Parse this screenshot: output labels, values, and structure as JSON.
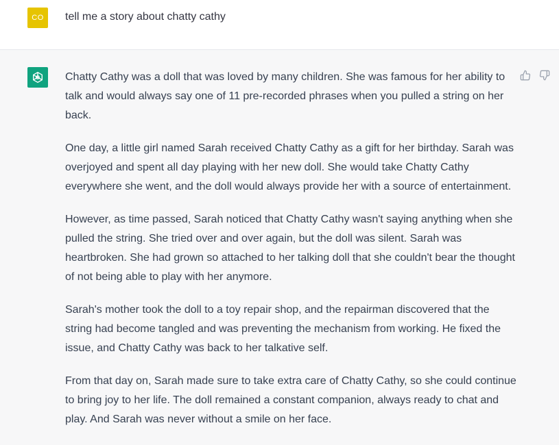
{
  "conversation": {
    "user_turn": {
      "avatar_initials": "CO",
      "message": "tell me a story about chatty cathy"
    },
    "assistant_turn": {
      "avatar_icon": "openai-logo-icon",
      "paragraphs": [
        "Chatty Cathy was a doll that was loved by many children. She was famous for her ability to talk and would always say one of 11 pre-recorded phrases when you pulled a string on her back.",
        "One day, a little girl named Sarah received Chatty Cathy as a gift for her birthday. Sarah was overjoyed and spent all day playing with her new doll. She would take Chatty Cathy everywhere she went, and the doll would always provide her with a source of entertainment.",
        "However, as time passed, Sarah noticed that Chatty Cathy wasn't saying anything when she pulled the string. She tried over and over again, but the doll was silent. Sarah was heartbroken. She had grown so attached to her talking doll that she couldn't bear the thought of not being able to play with her anymore.",
        "Sarah's mother took the doll to a toy repair shop, and the repairman discovered that the string had become tangled and was preventing the mechanism from working. He fixed the issue, and Chatty Cathy was back to her talkative self.",
        "From that day on, Sarah made sure to take extra care of Chatty Cathy, so she could continue to bring joy to her life. The doll remained a constant companion, always ready to chat and play. And Sarah was never without a smile on her face."
      ],
      "feedback": {
        "thumbs_up_icon": "thumbs-up-icon",
        "thumbs_down_icon": "thumbs-down-icon"
      }
    }
  },
  "colors": {
    "user_avatar_bg": "#e6c400",
    "assistant_avatar_bg": "#10a37f",
    "assistant_turn_bg": "#f7f7f8",
    "text": "#374151"
  }
}
